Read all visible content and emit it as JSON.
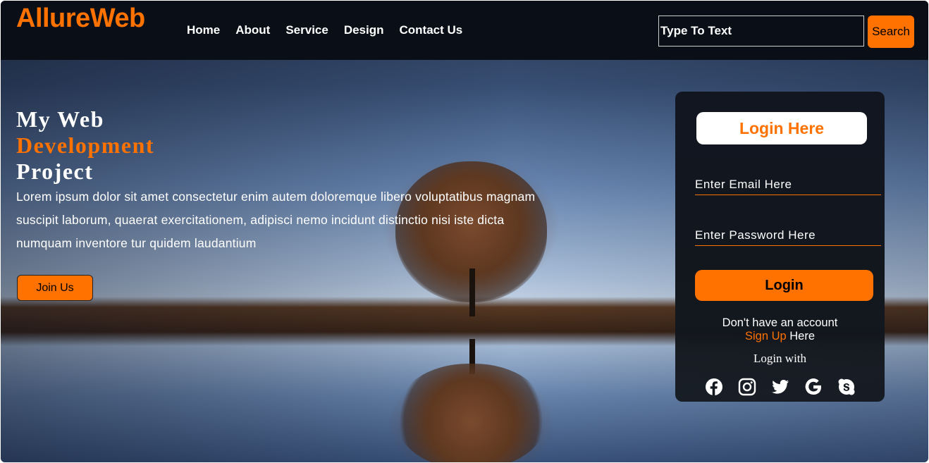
{
  "nav": {
    "logo": "AllureWeb",
    "links": [
      "Home",
      "About",
      "Service",
      "Design",
      "Contact Us"
    ],
    "search_placeholder": "Type To Text",
    "search_button": "Search"
  },
  "hero": {
    "line1": "My Web",
    "line2": "Development",
    "line3": "Project",
    "paragraph": "Lorem ipsum dolor sit amet consectetur enim autem doloremque libero voluptatibus magnam suscipit laborum, quaerat exercitationem, adipisci nemo incidunt distinctio nisi iste dicta numquam inventore tur quidem laudantium",
    "join_button": "Join Us"
  },
  "login": {
    "title": "Login Here",
    "email_placeholder": "Enter Email Here",
    "password_placeholder": "Enter Password Here",
    "button": "Login",
    "no_account": "Don't have an account",
    "signup_link": "Sign Up",
    "signup_suffix": " Here",
    "login_with": "Login with",
    "social_icons": [
      "facebook-icon",
      "instagram-icon",
      "twitter-icon",
      "google-icon",
      "skype-icon"
    ]
  },
  "colors": {
    "accent": "#ff7200",
    "nav_bg": "#0a0f17",
    "card_bg": "#111620"
  }
}
